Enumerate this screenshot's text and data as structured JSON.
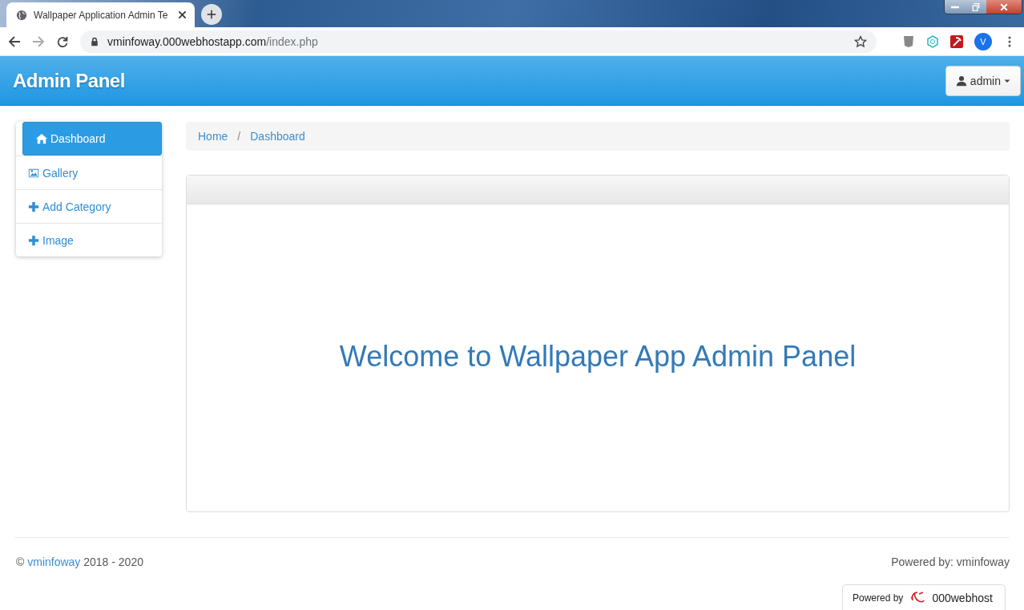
{
  "browser": {
    "tab_title": "Wallpaper Application Admin Te",
    "url_host": "vminfoway.000webhostapp.com",
    "url_path": "/index.php",
    "profile_initial": "V"
  },
  "navbar": {
    "brand": "Admin Panel",
    "user_menu": "admin"
  },
  "sidebar": {
    "items": [
      {
        "label": "Dashboard",
        "kind": "home",
        "selected": true
      },
      {
        "label": "Gallery",
        "kind": "gallery",
        "selected": false
      },
      {
        "label": "Add Category",
        "kind": "add",
        "selected": false
      },
      {
        "label": "Image",
        "kind": "add",
        "selected": false
      }
    ]
  },
  "breadcrumb": {
    "items": [
      "Home",
      "Dashboard"
    ],
    "separator": "/"
  },
  "panel": {
    "welcome": "Welcome to Wallpaper App Admin Panel"
  },
  "footer": {
    "copyright": "©",
    "link": "vminfoway",
    "years": "2018 - 2020",
    "powered": "Powered by: vminfoway"
  },
  "host_badge": {
    "label": "Powered by",
    "brand": "000webhost"
  }
}
